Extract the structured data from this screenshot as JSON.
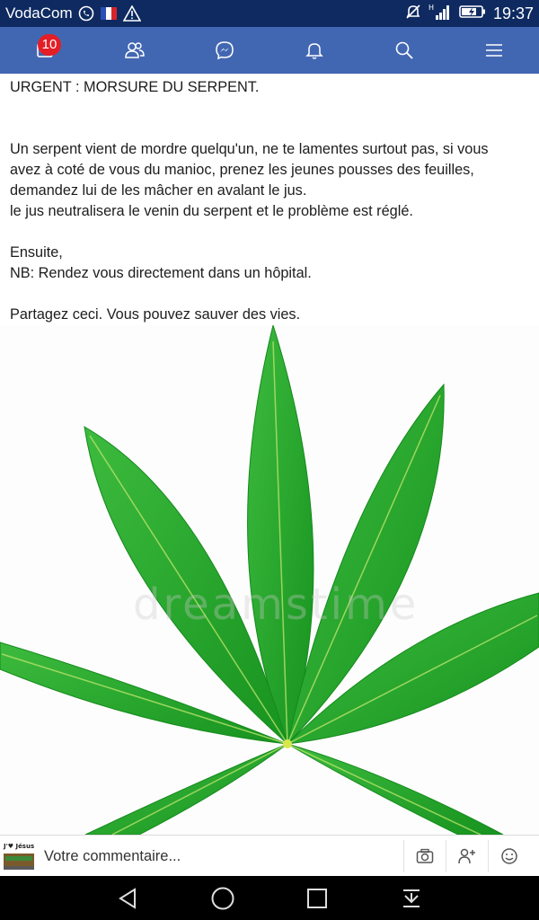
{
  "status": {
    "carrier": "VodaCom",
    "time": "19:37",
    "icons": [
      "whatsapp-icon",
      "france-flag-icon",
      "warning-icon",
      "mute-icon",
      "signal-icon",
      "battery-icon"
    ]
  },
  "nav": {
    "notification_count": "10",
    "items": [
      "news-feed-icon",
      "friends-icon",
      "messenger-icon",
      "bell-icon",
      "search-icon",
      "menu-icon"
    ]
  },
  "post": {
    "title": "URGENT : MORSURE DU SERPENT.",
    "body_lines": [
      "Un serpent vient de mordre quelqu'un, ne te lamentes surtout pas, si vous",
      "avez à coté de vous du manioc,   prenez les jeunes pousses des feuilles,",
      "demandez lui de les mâcher en avalant le jus.",
      "le jus neutralisera le venin du serpent et le problème est réglé."
    ],
    "then": "Ensuite,",
    "nb": "NB: Rendez vous directement dans un hôpital.",
    "share": "Partagez ceci. Vous pouvez sauver des vies.",
    "image_watermark": "dreamstime"
  },
  "comment": {
    "placeholder": "Votre commentaire...",
    "avatar_text": "J'♥ Jésus"
  },
  "colors": {
    "status_bar": "#0e2a61",
    "nav_bar": "#4267b2",
    "badge": "#e41e26",
    "leaf": "#22a02c"
  }
}
